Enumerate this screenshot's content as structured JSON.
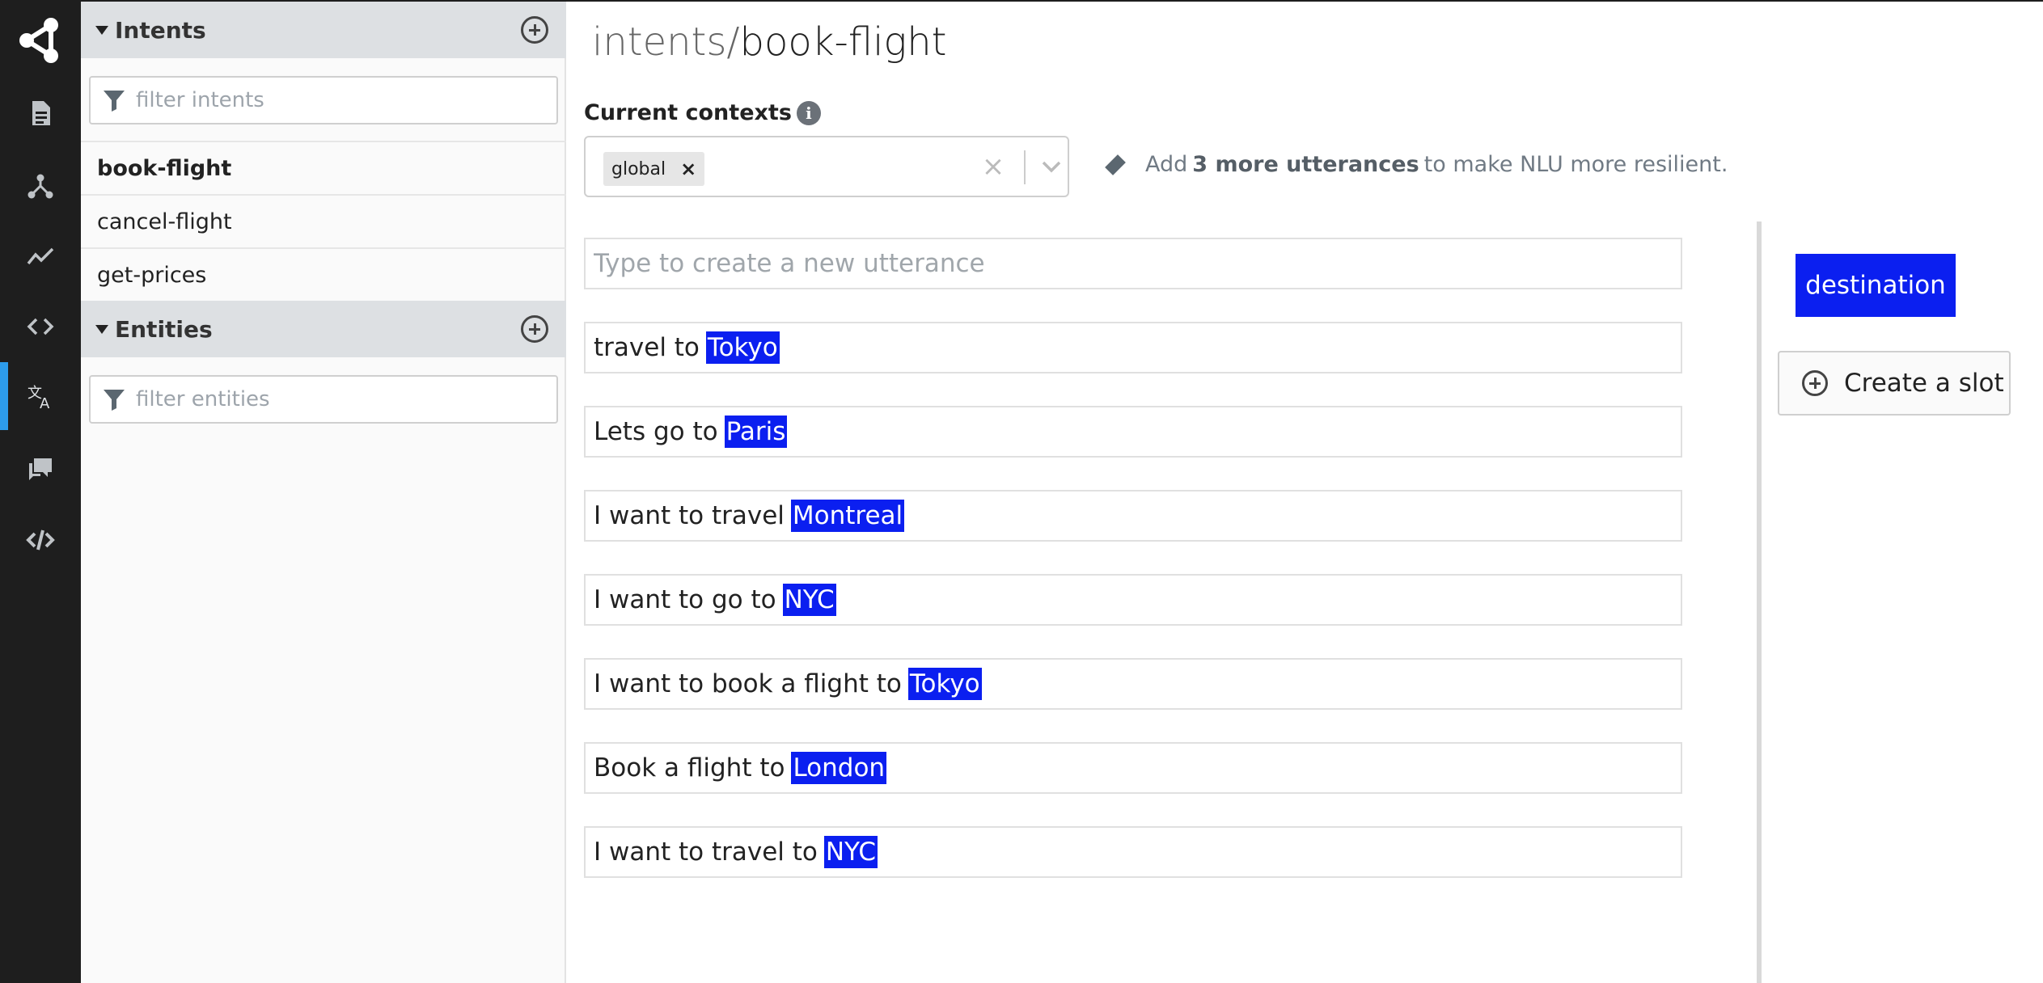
{
  "rail": {
    "items": [
      {
        "name": "logo",
        "icon": "share-network-icon"
      },
      {
        "name": "content",
        "icon": "document-icon"
      },
      {
        "name": "flows",
        "icon": "flow-diagram-icon"
      },
      {
        "name": "analytics",
        "icon": "analytics-line-icon"
      },
      {
        "name": "code",
        "icon": "code-brackets-icon"
      },
      {
        "name": "nlu",
        "icon": "translate-icon",
        "active": true
      },
      {
        "name": "qna",
        "icon": "chat-bubbles-icon"
      },
      {
        "name": "sdk",
        "icon": "slashed-code-icon"
      }
    ],
    "accent": "#2d9ceb"
  },
  "intents": {
    "title": "Intents",
    "filter_placeholder": "filter intents",
    "items": [
      "book-flight",
      "cancel-flight",
      "get-prices"
    ],
    "selected": "book-flight"
  },
  "entities": {
    "title": "Entities",
    "filter_placeholder": "filter entities"
  },
  "main": {
    "title_prefix": "intents/",
    "title_name": "book-flight",
    "contexts_label": "Current contexts",
    "context_tag": "global",
    "hint": {
      "pre": "Add",
      "bold": "3 more utterances",
      "post": "to make NLU more resilient."
    },
    "utterance_placeholder": "Type to create a new utterance",
    "utterances": [
      {
        "text": "travel to",
        "entity": "Tokyo"
      },
      {
        "text": "Lets go to",
        "entity": "Paris"
      },
      {
        "text": "I want to travel",
        "entity": "Montreal"
      },
      {
        "text": "I want to go to",
        "entity": "NYC"
      },
      {
        "text": "I want to book a flight to",
        "entity": "Tokyo"
      },
      {
        "text": "Book a flight to",
        "entity": "London"
      },
      {
        "text": "I want to travel to",
        "entity": "NYC"
      }
    ],
    "entity_color": "#0b1ff0"
  },
  "slots": {
    "tags": [
      "destination"
    ],
    "create_label": "Create a slot"
  }
}
